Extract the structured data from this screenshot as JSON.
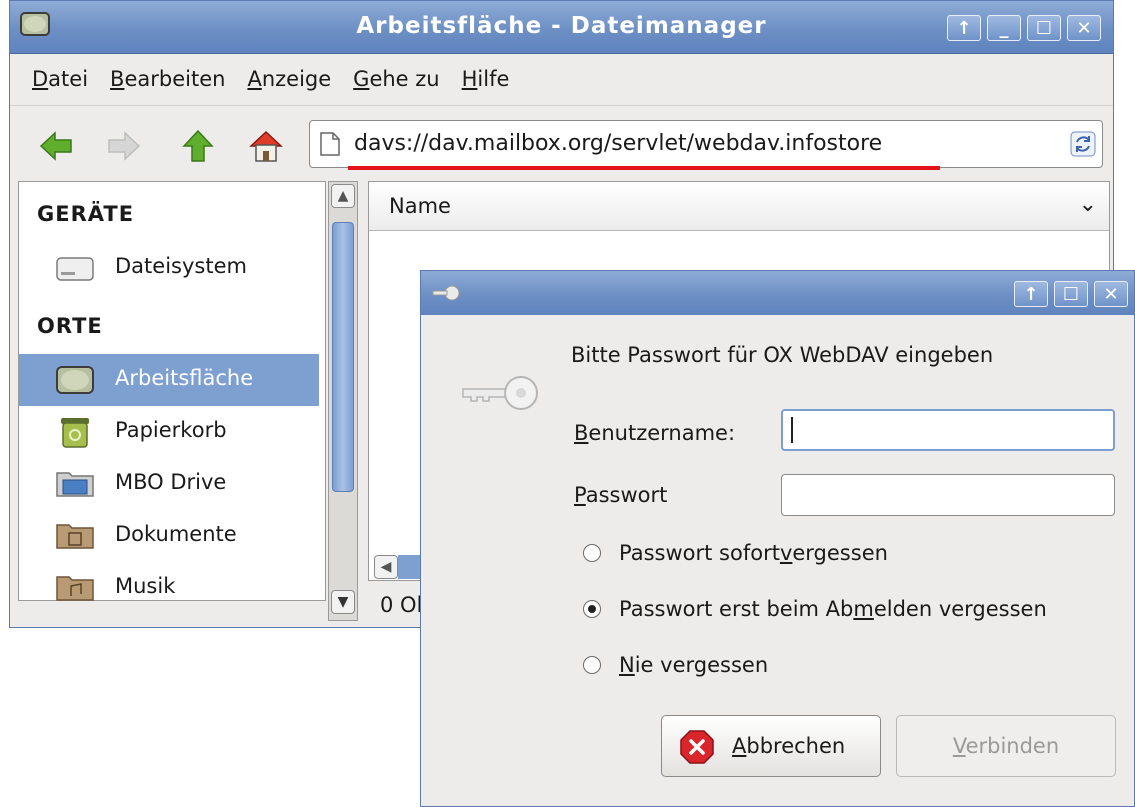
{
  "window": {
    "title": "Arbeitsfläche - Dateimanager",
    "controls": [
      "↑",
      "_",
      "☐",
      "✕"
    ]
  },
  "menu": {
    "items": [
      {
        "key": "D",
        "rest": "atei"
      },
      {
        "key": "B",
        "rest": "earbeiten"
      },
      {
        "key": "A",
        "rest": "nzeige"
      },
      {
        "key": "G",
        "rest": "ehe zu"
      },
      {
        "key": "H",
        "rest": "ilfe"
      }
    ]
  },
  "toolbar": {
    "address": "davs://dav.mailbox.org/servlet/webdav.infostore",
    "icons": [
      "back-arrow-icon",
      "forward-arrow-icon",
      "up-arrow-icon",
      "home-icon",
      "reload-icon"
    ]
  },
  "sidebar": {
    "section_devices": "GERÄTE",
    "section_places": "ORTE",
    "devices": [
      {
        "label": "Dateisystem",
        "icon": "drive-icon"
      }
    ],
    "places": [
      {
        "label": "Arbeitsfläche",
        "icon": "desktop-icon",
        "selected": true
      },
      {
        "label": "Papierkorb",
        "icon": "trash-icon"
      },
      {
        "label": "MBO Drive",
        "icon": "network-folder-icon"
      },
      {
        "label": "Dokumente",
        "icon": "documents-folder-icon"
      },
      {
        "label": "Musik",
        "icon": "music-folder-icon"
      }
    ]
  },
  "fileview": {
    "column_name": "Name",
    "status": "0 Ob"
  },
  "dialog": {
    "controls": [
      "↑",
      "☐",
      "✕"
    ],
    "prompt": "Bitte Passwort für OX WebDAV eingeben",
    "username_label": {
      "key": "B",
      "rest": "enutzername:"
    },
    "password_label": {
      "key": "P",
      "rest": "asswort"
    },
    "username_value": "",
    "password_value": "",
    "radio_forget_now": {
      "before": "Passwort sofort ",
      "key": "v",
      "after": "ergessen"
    },
    "radio_forget_logout": {
      "before": "Passwort erst beim Ab",
      "key": "m",
      "after": "elden vergessen"
    },
    "radio_never": {
      "before": "",
      "key": "N",
      "after": "ie vergessen"
    },
    "selected_option": "forget_logout",
    "cancel_button": {
      "key": "A",
      "rest": "bbrechen"
    },
    "connect_button": {
      "key": "V",
      "rest": "erbinden"
    }
  }
}
